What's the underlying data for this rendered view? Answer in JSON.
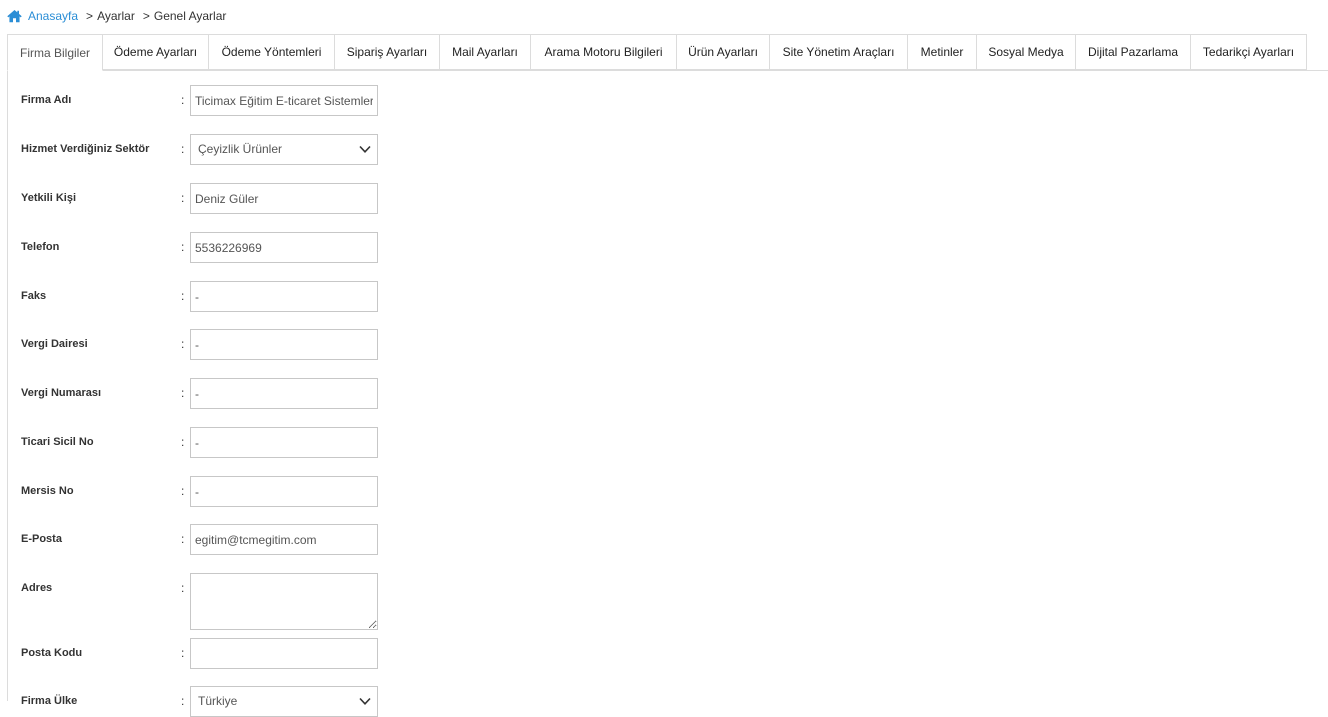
{
  "breadcrumb": {
    "home_icon": "home-icon",
    "home": "Anasayfa",
    "sep1": ">",
    "level1": "Ayarlar",
    "sep2": ">",
    "level2": "Genel Ayarlar"
  },
  "colors": {
    "link": "#2b8ed6",
    "border": "#dcdcdc",
    "field_border": "#c7c7c7"
  },
  "tabs": [
    {
      "label": "Firma Bilgiler",
      "active": true
    },
    {
      "label": "Ödeme Ayarları"
    },
    {
      "label": "Ödeme Yöntemleri"
    },
    {
      "label": "Sipariş Ayarları"
    },
    {
      "label": "Mail Ayarları"
    },
    {
      "label": "Arama Motoru Bilgileri"
    },
    {
      "label": "Ürün Ayarları"
    },
    {
      "label": "Site Yönetim Araçları"
    },
    {
      "label": "Metinler"
    },
    {
      "label": "Sosyal Medya"
    },
    {
      "label": "Dijital Pazarlama"
    },
    {
      "label": "Tedarikçi Ayarları"
    }
  ],
  "form": {
    "colon": ":",
    "firma_adi": {
      "label": "Firma Adı",
      "value": "Ticimax Eğitim E-ticaret Sistemleri"
    },
    "sektor": {
      "label": "Hizmet Verdiğiniz Sektör",
      "value": "Çeyizlik Ürünler"
    },
    "yetkili": {
      "label": "Yetkili Kişi",
      "value": "Deniz Güler"
    },
    "telefon": {
      "label": "Telefon",
      "value": "5536226969"
    },
    "faks": {
      "label": "Faks",
      "value": "-"
    },
    "vergi_dairesi": {
      "label": "Vergi Dairesi",
      "value": "-"
    },
    "vergi_no": {
      "label": "Vergi Numarası",
      "value": "-"
    },
    "sicil_no": {
      "label": "Ticari Sicil No",
      "value": "-"
    },
    "mersis_no": {
      "label": "Mersis No",
      "value": "-"
    },
    "eposta": {
      "label": "E-Posta",
      "value": "egitim@tcmegitim.com"
    },
    "adres": {
      "label": "Adres",
      "value": ""
    },
    "posta_kodu": {
      "label": "Posta Kodu",
      "value": ""
    },
    "ulke": {
      "label": "Firma Ülke",
      "value": "Türkiye"
    }
  }
}
